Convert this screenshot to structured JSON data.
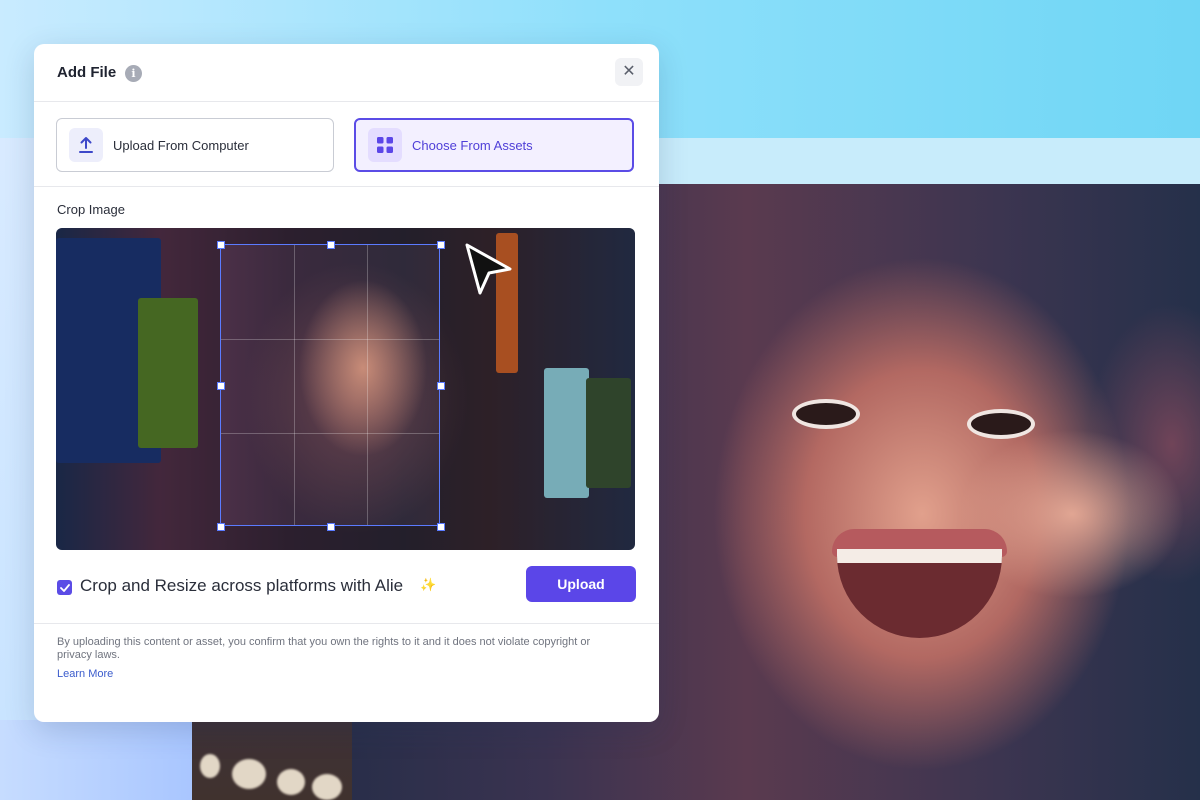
{
  "modal": {
    "title": "Add File",
    "info_icon": "info-icon",
    "close_icon": "close-icon"
  },
  "sources": {
    "computer": {
      "label": "Upload From Computer",
      "icon": "upload-icon"
    },
    "assets": {
      "label": "Choose From Assets",
      "icon": "grid-icon",
      "selected": true
    }
  },
  "crop": {
    "label": "Crop Image",
    "cursor_icon": "cursor-arrow-icon"
  },
  "options": {
    "crop_resize_label": "Crop and Resize across platforms with Alie",
    "crop_resize_checked": true,
    "sparkle": "✨"
  },
  "actions": {
    "upload_label": "Upload"
  },
  "footer": {
    "disclaimer": "By uploading this content or asset, you confirm that you own the rights to it and it does not violate copyright or privacy laws.",
    "learn_more": "Learn More"
  },
  "colors": {
    "accent": "#5b46e8",
    "selected_bg": "#f3f0ff",
    "link": "#3b5ccc"
  }
}
